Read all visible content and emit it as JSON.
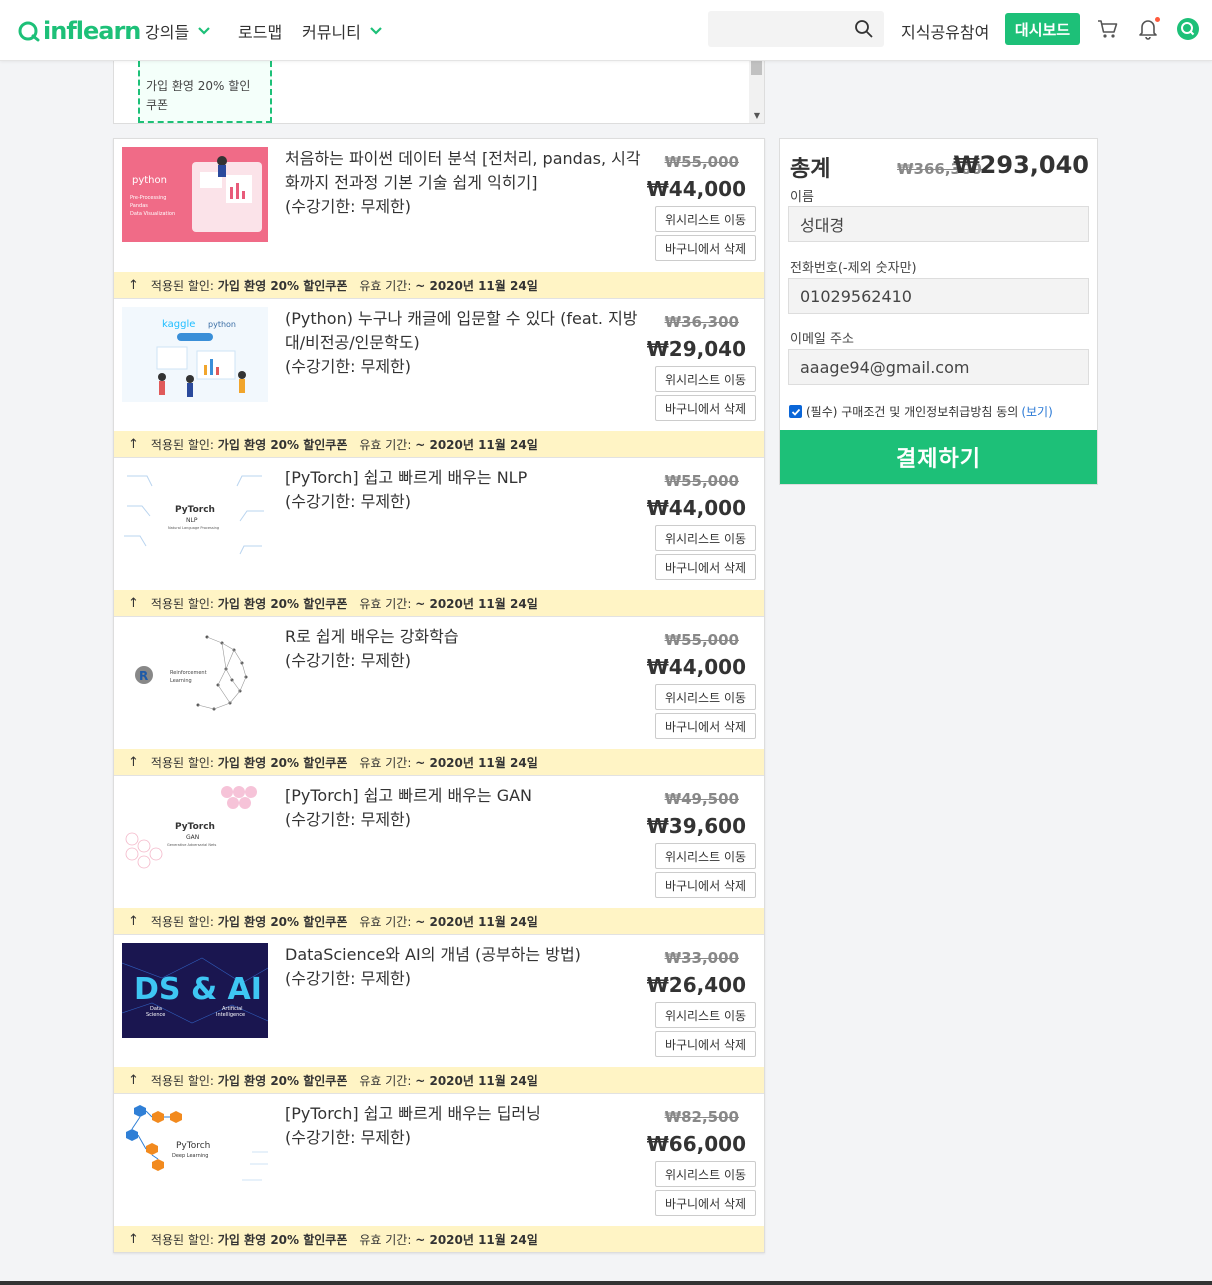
{
  "header": {
    "logo_text": "inflearn",
    "nav": [
      {
        "label": "강의들",
        "has_dropdown": true
      },
      {
        "label": "로드맵",
        "has_dropdown": false
      },
      {
        "label": "커뮤니티",
        "has_dropdown": true
      }
    ],
    "search_placeholder": "",
    "share_link": "지식공유참여",
    "dashboard_button": "대시보드",
    "icons": [
      "search-icon",
      "cart-icon",
      "bell-icon",
      "profile-icon"
    ]
  },
  "coupon_strip": {
    "coupon_text": "가입 환영 20% 할인 쿠폰"
  },
  "cart_items": [
    {
      "title": "처음하는 파이썬 데이터 분석 [전처리, pandas, 시각화까지 전과정 기본 기술 쉽게 익히기]",
      "period": "(수강기한: 무제한)",
      "old_price": "₩55,000",
      "new_price": "₩44,000",
      "wishlist_label": "위시리스트 이동",
      "delete_label": "바구니에서 삭제",
      "thumb_text": "python",
      "thumb_sub": "Pre-Processing · Pandas · Data Visualization",
      "discount_prefix": "적용된 할인:",
      "discount_name": "가입 환영 20% 할인쿠폰",
      "valid_prefix": "유효 기간:",
      "valid_until": "~ 2020년 11월 24일"
    },
    {
      "title": "(Python) 누구나 캐글에 입문할 수 있다 (feat. 지방대/비전공/인문학도)",
      "period": "(수강기한: 무제한)",
      "old_price": "₩36,300",
      "new_price": "₩29,040",
      "wishlist_label": "위시리스트 이동",
      "delete_label": "바구니에서 삭제",
      "thumb_text": "kaggle",
      "thumb_sub": "python",
      "discount_prefix": "적용된 할인:",
      "discount_name": "가입 환영 20% 할인쿠폰",
      "valid_prefix": "유효 기간:",
      "valid_until": "~ 2020년 11월 24일"
    },
    {
      "title": "[PyTorch] 쉽고 빠르게 배우는 NLP",
      "period": "(수강기한: 무제한)",
      "old_price": "₩55,000",
      "new_price": "₩44,000",
      "wishlist_label": "위시리스트 이동",
      "delete_label": "바구니에서 삭제",
      "thumb_text": "PyTorch",
      "thumb_sub": "NLP",
      "discount_prefix": "적용된 할인:",
      "discount_name": "가입 환영 20% 할인쿠폰",
      "valid_prefix": "유효 기간:",
      "valid_until": "~ 2020년 11월 24일"
    },
    {
      "title": "R로 쉽게 배우는 강화학습",
      "period": "(수강기한: 무제한)",
      "old_price": "₩55,000",
      "new_price": "₩44,000",
      "wishlist_label": "위시리스트 이동",
      "delete_label": "바구니에서 삭제",
      "thumb_text": "Reinforcement",
      "thumb_sub": "Learning",
      "discount_prefix": "적용된 할인:",
      "discount_name": "가입 환영 20% 할인쿠폰",
      "valid_prefix": "유효 기간:",
      "valid_until": "~ 2020년 11월 24일"
    },
    {
      "title": "[PyTorch] 쉽고 빠르게 배우는 GAN",
      "period": "(수강기한: 무제한)",
      "old_price": "₩49,500",
      "new_price": "₩39,600",
      "wishlist_label": "위시리스트 이동",
      "delete_label": "바구니에서 삭제",
      "thumb_text": "PyTorch",
      "thumb_sub": "GAN",
      "discount_prefix": "적용된 할인:",
      "discount_name": "가입 환영 20% 할인쿠폰",
      "valid_prefix": "유효 기간:",
      "valid_until": "~ 2020년 11월 24일"
    },
    {
      "title": "DataScience와 AI의 개념 (공부하는 방법)",
      "period": "(수강기한: 무제한)",
      "old_price": "₩33,000",
      "new_price": "₩26,400",
      "wishlist_label": "위시리스트 이동",
      "delete_label": "바구니에서 삭제",
      "thumb_text": "DS & AI",
      "thumb_sub": "Data Science · Artificial Intelligence",
      "discount_prefix": "적용된 할인:",
      "discount_name": "가입 환영 20% 할인쿠폰",
      "valid_prefix": "유효 기간:",
      "valid_until": "~ 2020년 11월 24일"
    },
    {
      "title": "[PyTorch] 쉽고 빠르게 배우는 딥러닝",
      "period": "(수강기한: 무제한)",
      "old_price": "₩82,500",
      "new_price": "₩66,000",
      "wishlist_label": "위시리스트 이동",
      "delete_label": "바구니에서 삭제",
      "thumb_text": "PyTorch",
      "thumb_sub": "Deep Learning",
      "discount_prefix": "적용된 할인:",
      "discount_name": "가입 환영 20% 할인쿠폰",
      "valid_prefix": "유효 기간:",
      "valid_until": "~ 2020년 11월 24일"
    }
  ],
  "summary": {
    "title": "총계",
    "old_total": "₩366,300",
    "new_total": "₩293,040",
    "name_label": "이름",
    "name_value": "성대경",
    "phone_label": "전화번호(-제외 숫자만)",
    "phone_value": "01029562410",
    "email_label": "이메일 주소",
    "email_value": "aaage94@gmail.com",
    "agree_text": "(필수) 구매조건 및 개인정보취급방침 동의",
    "agree_link": "(보기)",
    "agree_checked": true,
    "pay_button": "결제하기"
  },
  "colors": {
    "brand": "#1dc078",
    "discount_bg": "#fff4c5",
    "checkbox": "#0a66d8",
    "link": "#2b7ad6"
  }
}
